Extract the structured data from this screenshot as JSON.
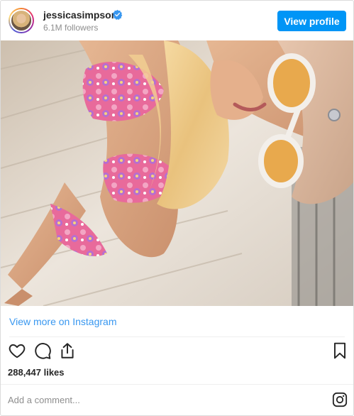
{
  "header": {
    "username": "jessicasimpson",
    "verified": true,
    "followers": "6.1M followers",
    "view_profile_label": "View profile"
  },
  "post": {
    "view_more_label": "View more on Instagram",
    "likes": "288,447 likes",
    "comment_placeholder": "Add a comment..."
  },
  "icons": {
    "like": "heart-icon",
    "comment": "comment-icon",
    "share": "share-icon",
    "save": "bookmark-icon",
    "instagram": "instagram-logo-icon",
    "verified": "verified-badge-icon"
  },
  "colors": {
    "accent": "#0095f6",
    "link": "#3897f0",
    "text": "#262626",
    "muted": "#8e8e8e",
    "border": "#dbdbdb"
  }
}
